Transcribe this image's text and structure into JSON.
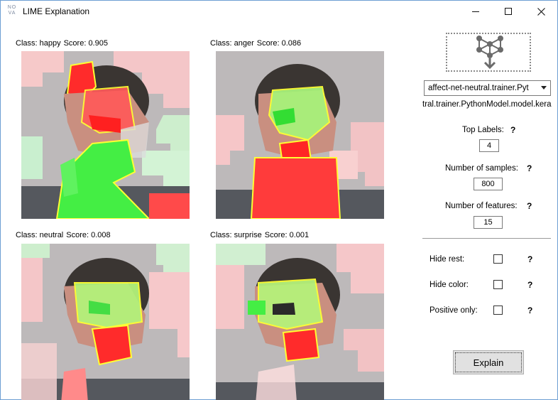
{
  "window": {
    "title": "LIME Explanation",
    "icon_text_top": "NO",
    "icon_text_bottom": "VA"
  },
  "panels": [
    {
      "class_label": "Class: happy",
      "score_label": "Score: 0.905"
    },
    {
      "class_label": "Class: anger",
      "score_label": "Score: 0.086"
    },
    {
      "class_label": "Class: neutral",
      "score_label": "Score: 0.008"
    },
    {
      "class_label": "Class: surprise",
      "score_label": "Score: 0.001"
    }
  ],
  "controls": {
    "model_select_value": "affect-net-neutral.trainer.Pyt",
    "model_path": "tral.trainer.PythonModel.model.kera",
    "top_labels": {
      "label": "Top Labels:",
      "value": "4",
      "help": "?"
    },
    "num_samples": {
      "label": "Number of samples:",
      "value": "800",
      "help": "?"
    },
    "num_features": {
      "label": "Number of features:",
      "value": "15",
      "help": "?"
    },
    "hide_rest": {
      "label": "Hide rest:",
      "checked": false,
      "help": "?"
    },
    "hide_color": {
      "label": "Hide color:",
      "checked": false,
      "help": "?"
    },
    "positive_only": {
      "label": "Positive only:",
      "checked": false,
      "help": "?"
    },
    "explain_label": "Explain"
  },
  "colors": {
    "positive_overlay": "#33ee33",
    "negative_overlay": "#ff3333",
    "boundary": "#ffff33",
    "background_gray": "#b9b6b8"
  }
}
